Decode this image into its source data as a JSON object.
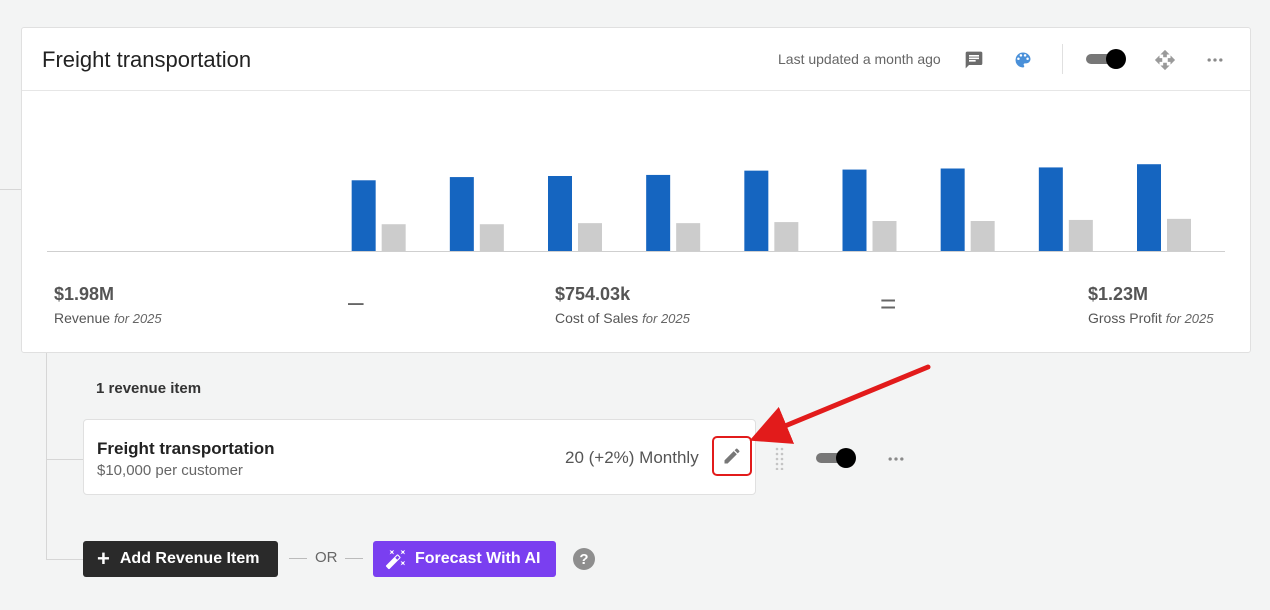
{
  "card": {
    "title": "Freight transportation",
    "last_updated": "Last updated a month ago",
    "icons": {
      "comment": "comment-icon",
      "palette": "palette-icon",
      "move": "move-icon",
      "more": "more-icon"
    },
    "toggle_on": true
  },
  "chart_data": {
    "type": "bar",
    "categories": [
      "",
      "",
      "",
      "",
      "",
      "",
      "",
      "",
      "",
      "",
      "",
      ""
    ],
    "series": [
      {
        "name": "",
        "color": "#1565c0",
        "values": [
          0,
          0,
          0,
          66,
          69,
          70,
          71,
          75,
          76,
          77,
          78,
          81
        ]
      },
      {
        "name": "",
        "color": "#cccccc",
        "values": [
          0,
          0,
          0,
          25,
          25,
          26,
          26,
          27,
          28,
          28,
          29,
          30
        ]
      }
    ],
    "ylim": [
      0,
      140
    ],
    "grid": false,
    "legend": "none"
  },
  "summary": {
    "revenue": {
      "value": "$1.98M",
      "label": "Revenue",
      "period": "for 2025"
    },
    "minus": "–",
    "cost": {
      "value": "$754.03k",
      "label": "Cost of Sales",
      "period": "for 2025"
    },
    "equals": "=",
    "profit": {
      "value": "$1.23M",
      "label": "Gross Profit",
      "period": "for 2025"
    }
  },
  "revenue_section": {
    "count_label": "1 revenue item",
    "items": [
      {
        "name": "Freight transportation",
        "subtitle": "$10,000 per customer",
        "rate": "20 (+2%) Monthly",
        "toggle_on": true
      }
    ]
  },
  "actions": {
    "add_label": "Add Revenue Item",
    "or_label": "OR",
    "ai_label": "Forecast With AI",
    "help": "?"
  },
  "colors": {
    "accent_blue": "#1565c0",
    "bar_gray": "#cccccc",
    "ai_purple": "#7a3ff0",
    "annotation_red": "#e21b1b"
  }
}
